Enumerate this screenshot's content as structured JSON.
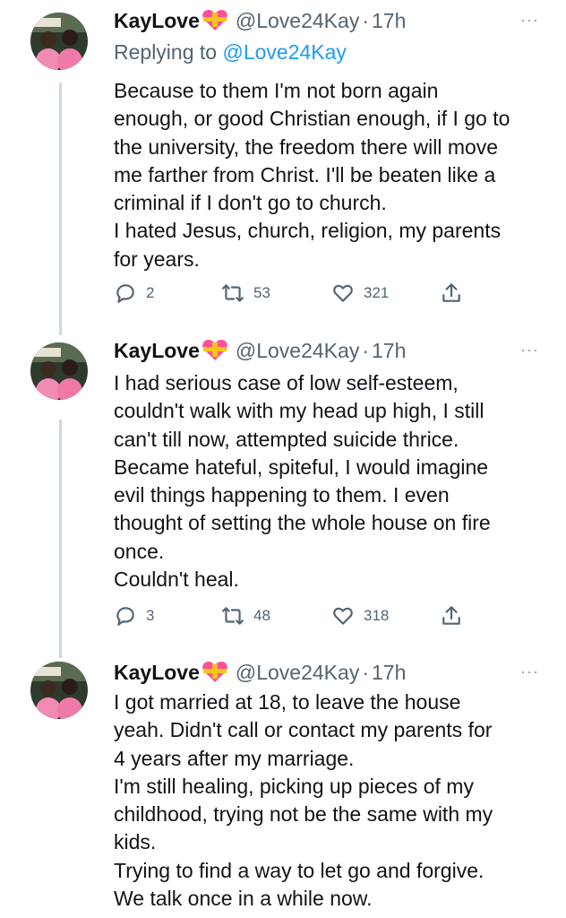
{
  "tweets": [
    {
      "name": "KayLove",
      "handle": "@Love24Kay",
      "separator": "·",
      "time": "17h",
      "more": "···",
      "replying_prefix": "Replying to",
      "replying_to": "@Love24Kay",
      "text": "Because to them I'm not born again\nenough, or good Christian enough, if I go to\nthe university, the freedom there will move\nme farther from Christ. I'll be beaten like a\ncriminal if I don't go to church.\nI hated Jesus, church, religion, my parents\nfor years.",
      "replies": "2",
      "retweets": "53",
      "likes": "321"
    },
    {
      "name": "KayLove",
      "handle": "@Love24Kay",
      "separator": "·",
      "time": "17h",
      "more": "···",
      "text": "I had serious case of low self-esteem,\ncouldn't walk with my head up high, I still\ncan't till now, attempted suicide thrice.\nBecame hateful, spiteful, I would imagine\nevil things happening to them. I even\nthought of setting the whole house on fire\nonce.\nCouldn't heal.",
      "replies": "3",
      "retweets": "48",
      "likes": "318"
    },
    {
      "name": "KayLove",
      "handle": "@Love24Kay",
      "separator": "·",
      "time": "17h",
      "more": "···",
      "text": "I got married at 18, to leave the house\nyeah. Didn't call or contact my parents for\n4 years after my marriage.\nI'm still healing, picking up pieces of my\nchildhood, trying not be the same with my\nkids.\nTrying to find a way to let go and forgive.\nWe talk once in a while now."
    }
  ],
  "colors": {
    "text": "#0f1419",
    "secondary": "#536471",
    "link": "#1d9bf0",
    "thread_line": "#cfd9de",
    "heart_pink": "#ff4f9a",
    "heart_gold": "#f5c518"
  },
  "icons": [
    "avatar-photo",
    "heart-ribbon-emoji",
    "more-dots-icon",
    "reply-icon",
    "retweet-icon",
    "like-icon",
    "share-icon"
  ]
}
